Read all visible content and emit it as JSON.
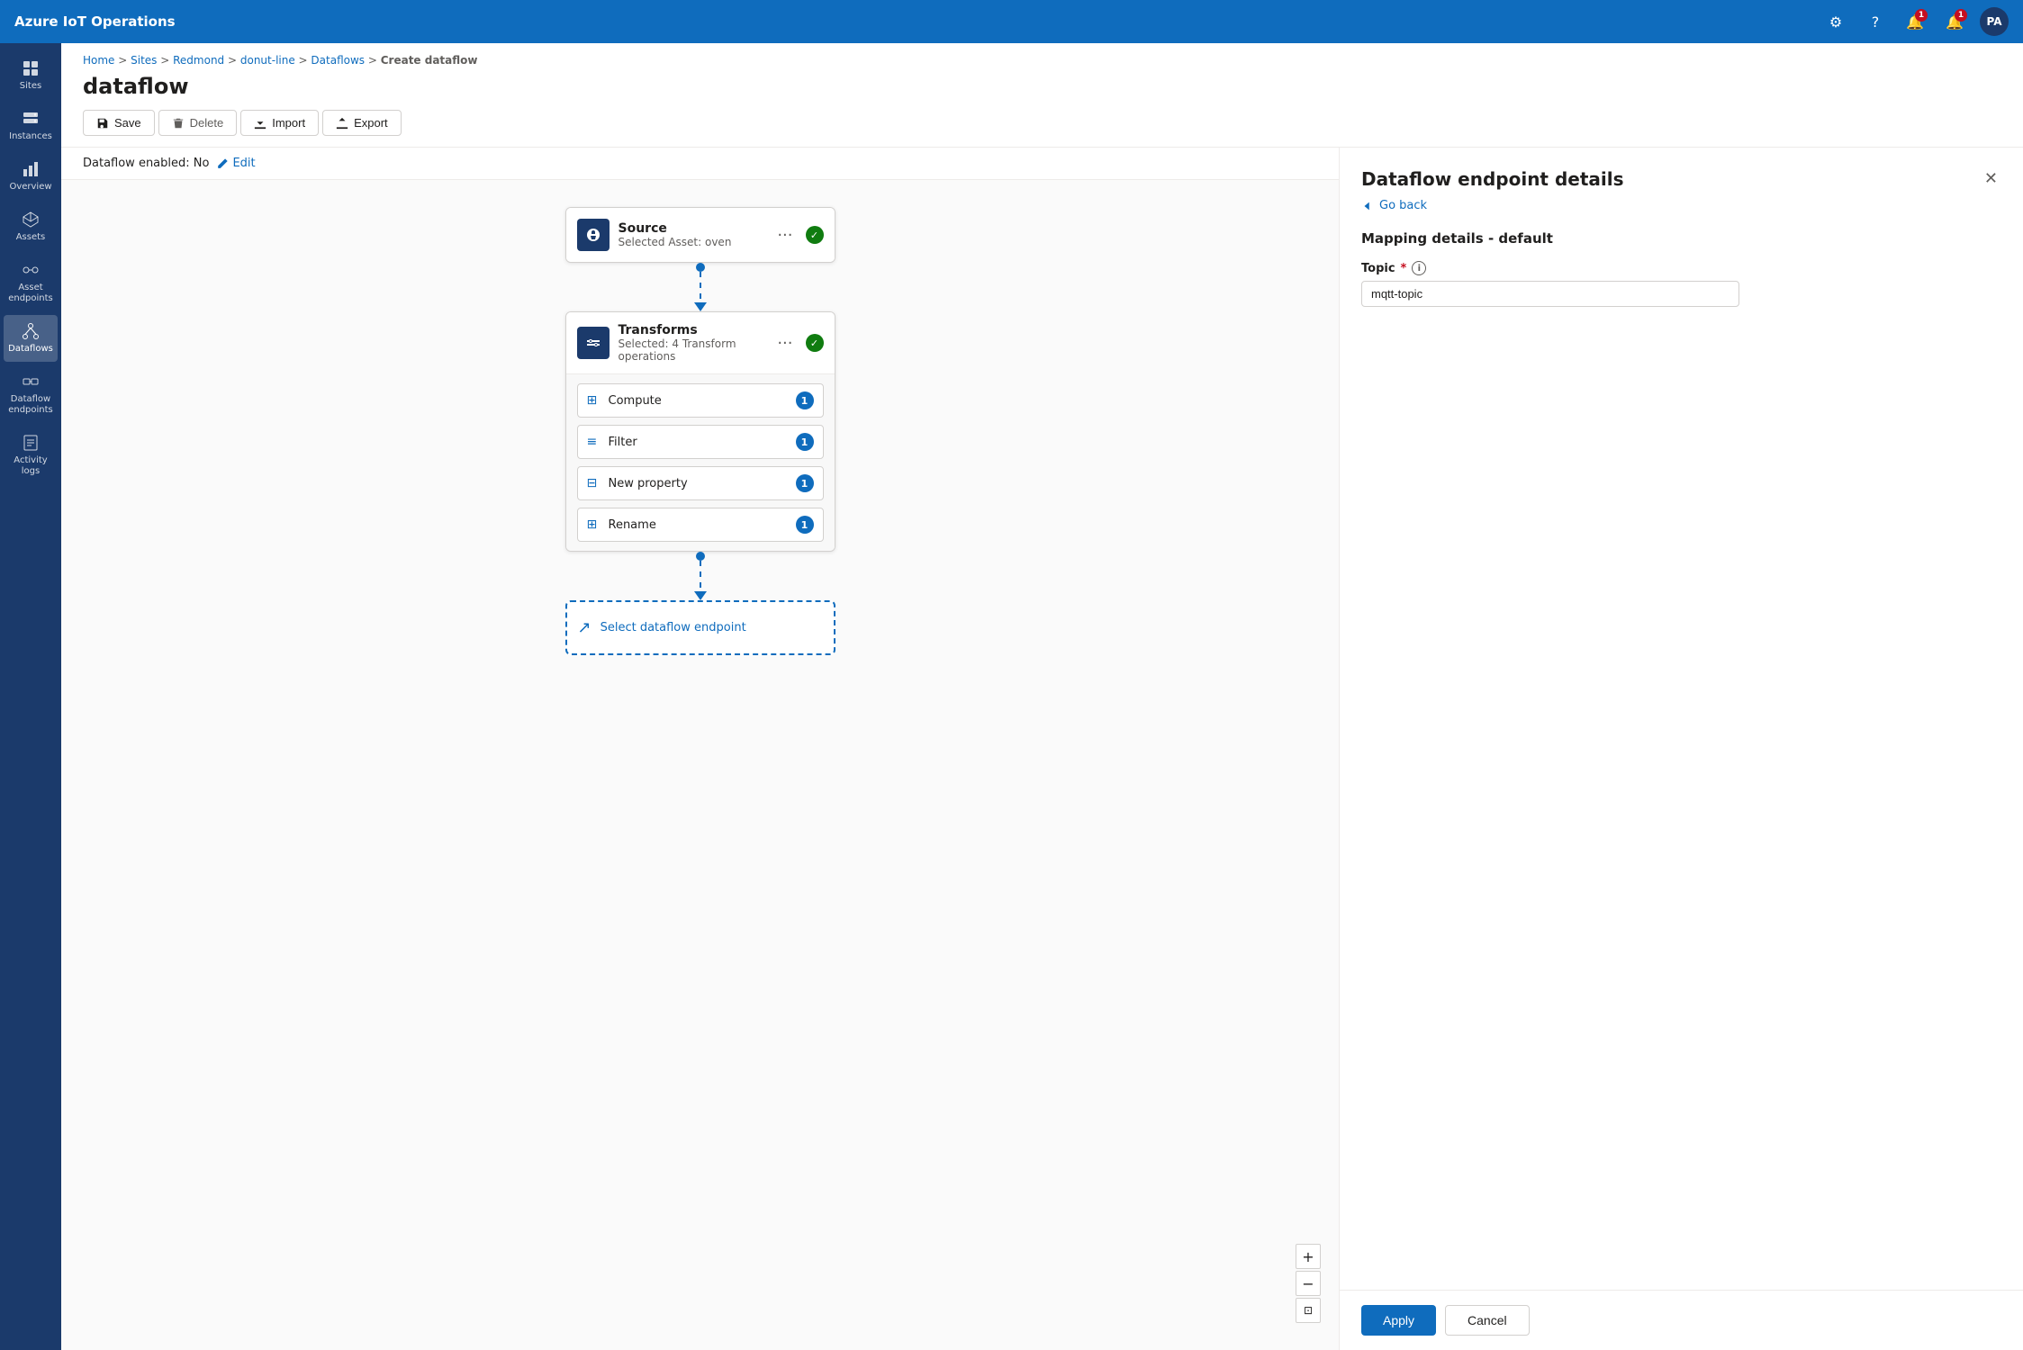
{
  "app": {
    "title": "Azure IoT Operations"
  },
  "topnav": {
    "title": "Azure IoT Operations",
    "settings_label": "Settings",
    "help_label": "Help",
    "notifications_label": "Notifications",
    "alerts_label": "Alerts",
    "avatar_label": "PA",
    "notifications_count": "1",
    "alerts_count": "1"
  },
  "sidebar": {
    "items": [
      {
        "id": "sites",
        "label": "Sites",
        "icon": "grid"
      },
      {
        "id": "instances",
        "label": "Instances",
        "icon": "server"
      },
      {
        "id": "overview",
        "label": "Overview",
        "icon": "chart"
      },
      {
        "id": "assets",
        "label": "Assets",
        "icon": "box"
      },
      {
        "id": "asset-endpoints",
        "label": "Asset endpoints",
        "icon": "link"
      },
      {
        "id": "dataflows",
        "label": "Dataflows",
        "icon": "flow",
        "active": true
      },
      {
        "id": "dataflow-endpoints",
        "label": "Dataflow endpoints",
        "icon": "endpoint"
      },
      {
        "id": "activity-logs",
        "label": "Activity logs",
        "icon": "log"
      }
    ]
  },
  "breadcrumb": {
    "items": [
      "Home",
      "Sites",
      "Redmond",
      "donut-line",
      "Dataflows",
      "Create dataflow"
    ],
    "separators": [
      ">",
      ">",
      ">",
      ">",
      ">"
    ]
  },
  "page": {
    "title": "dataflow"
  },
  "toolbar": {
    "save_label": "Save",
    "delete_label": "Delete",
    "import_label": "Import",
    "export_label": "Export"
  },
  "dataflow": {
    "enabled_label": "Dataflow enabled: No",
    "edit_label": "Edit"
  },
  "flow": {
    "source": {
      "title": "Source",
      "subtitle": "Selected Asset: oven"
    },
    "transforms": {
      "title": "Transforms",
      "subtitle": "Selected: 4 Transform operations",
      "children": [
        {
          "label": "Compute",
          "count": "1",
          "icon": "compute"
        },
        {
          "label": "Filter",
          "count": "1",
          "icon": "filter"
        },
        {
          "label": "New property",
          "count": "1",
          "icon": "property"
        },
        {
          "label": "Rename",
          "count": "1",
          "icon": "rename"
        }
      ]
    },
    "endpoint": {
      "label": "Select dataflow endpoint"
    }
  },
  "right_panel": {
    "title": "Dataflow endpoint details",
    "go_back_label": "Go back",
    "section_title": "Mapping details - default",
    "topic_label": "Topic",
    "topic_placeholder": "mqtt-topic",
    "topic_value": "mqtt-topic",
    "apply_label": "Apply",
    "cancel_label": "Cancel"
  },
  "canvas_controls": {
    "zoom_in": "+",
    "zoom_out": "−",
    "reset": "⊡"
  }
}
